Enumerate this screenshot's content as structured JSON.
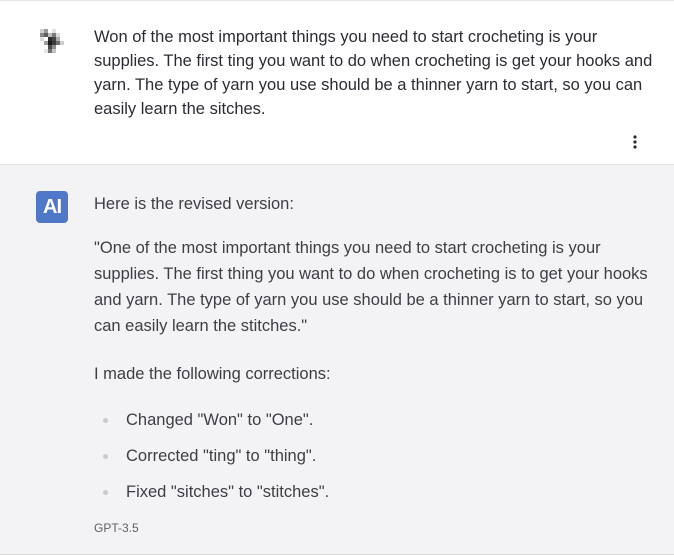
{
  "conversation": {
    "user_message": {
      "text": "Won of the most important things you need to start crocheting is your supplies. The first ting you want to do when crocheting is get your hooks and yarn. The type of yarn you use should be a thinner yarn to start, so you can easily learn the sitches."
    },
    "ai_message": {
      "avatar_label": "AI",
      "intro": "Here is the revised version:",
      "revised_text": "\"One of the most important things you need to start crocheting is your supplies. The first thing you want to do when crocheting is to get your hooks and yarn. The type of yarn you use should be a thinner yarn to start, so you can easily learn the stitches.\"",
      "corrections_intro": "I made the following corrections:",
      "corrections": [
        "Changed \"Won\" to \"One\".",
        "Corrected \"ting\" to \"thing\".",
        "Fixed \"sitches\" to \"stitches\"."
      ],
      "model": "GPT-3.5"
    }
  },
  "icons": {
    "user_avatar": "pixelated-avatar-icon",
    "menu": "more-vertical-icon"
  },
  "colors": {
    "ai_avatar_bg": "#4f78c8",
    "ai_message_bg": "#f3f3f5",
    "user_message_bg": "#ffffff"
  }
}
